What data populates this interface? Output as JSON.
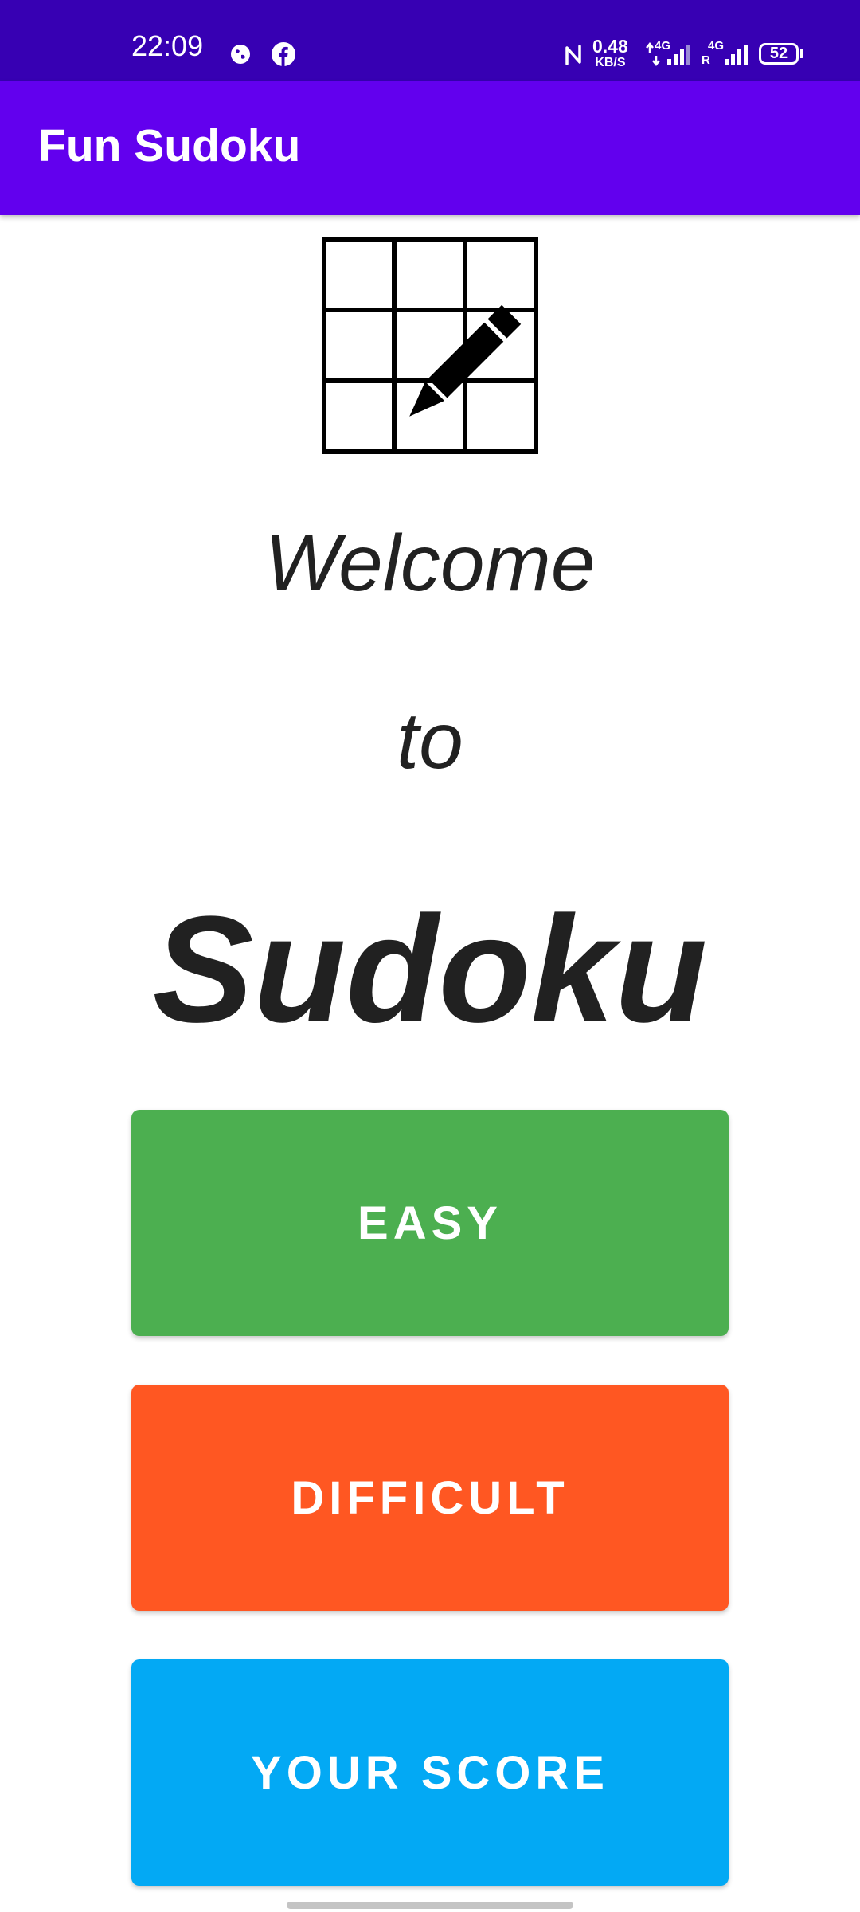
{
  "status_bar": {
    "time": "22:09",
    "net_speed_value": "0.48",
    "net_speed_unit": "KB/S",
    "sim1_tag": "4G",
    "sim2_tag": "4G",
    "sim2_roaming": "R",
    "battery_level": "52",
    "icons": [
      "vpn-globe-icon",
      "facebook-icon",
      "nfc-icon",
      "signal-sim1-icon",
      "signal-sim2-icon",
      "battery-icon"
    ]
  },
  "app_bar": {
    "title": "Fun Sudoku"
  },
  "logo": {
    "icon": "sudoku-grid-pencil-icon"
  },
  "welcome": {
    "line1": "Welcome",
    "line2": "to",
    "line3": "Sudoku"
  },
  "buttons": {
    "easy": {
      "label": "EASY",
      "color": "#4caf50"
    },
    "difficult": {
      "label": "DIFFICULT",
      "color": "#ff5722"
    },
    "score": {
      "label": "YOUR SCORE",
      "color": "#03a9f4"
    }
  },
  "colors": {
    "status_bar": "#3700b3",
    "app_bar": "#6200ee",
    "text": "#212121"
  }
}
